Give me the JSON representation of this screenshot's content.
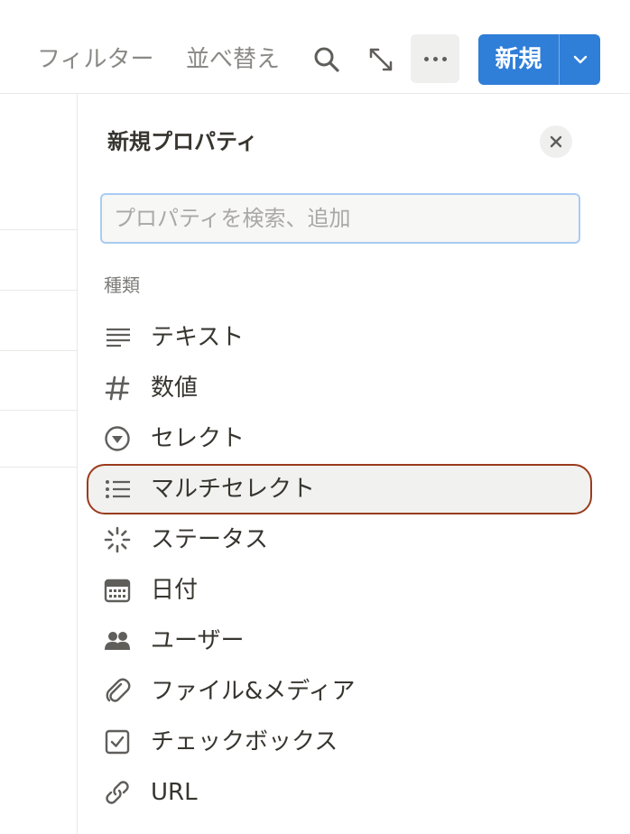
{
  "toolbar": {
    "filter_label": "フィルター",
    "sort_label": "並べ替え",
    "search_icon": "search-icon",
    "expand_icon": "expand-icon",
    "more_icon": "more-icon",
    "new_label": "新規",
    "new_dropdown_icon": "chevron-down-icon",
    "accent_color": "#2f7ed8"
  },
  "panel": {
    "title": "新規プロパティ",
    "close_icon": "close-icon",
    "search": {
      "placeholder": "プロパティを検索、追加",
      "value": ""
    },
    "section_label": "種類",
    "selected_outline_color": "#9b3b1c",
    "types": [
      {
        "label": "テキスト",
        "icon": "text-lines-icon"
      },
      {
        "label": "数値",
        "icon": "hash-icon"
      },
      {
        "label": "セレクト",
        "icon": "select-icon"
      },
      {
        "label": "マルチセレクト",
        "icon": "list-icon",
        "selected": true
      },
      {
        "label": "ステータス",
        "icon": "status-icon"
      },
      {
        "label": "日付",
        "icon": "calendar-icon"
      },
      {
        "label": "ユーザー",
        "icon": "people-icon"
      },
      {
        "label": "ファイル&メディア",
        "icon": "paperclip-icon"
      },
      {
        "label": "チェックボックス",
        "icon": "checkbox-icon"
      },
      {
        "label": "URL",
        "icon": "link-icon"
      }
    ]
  }
}
